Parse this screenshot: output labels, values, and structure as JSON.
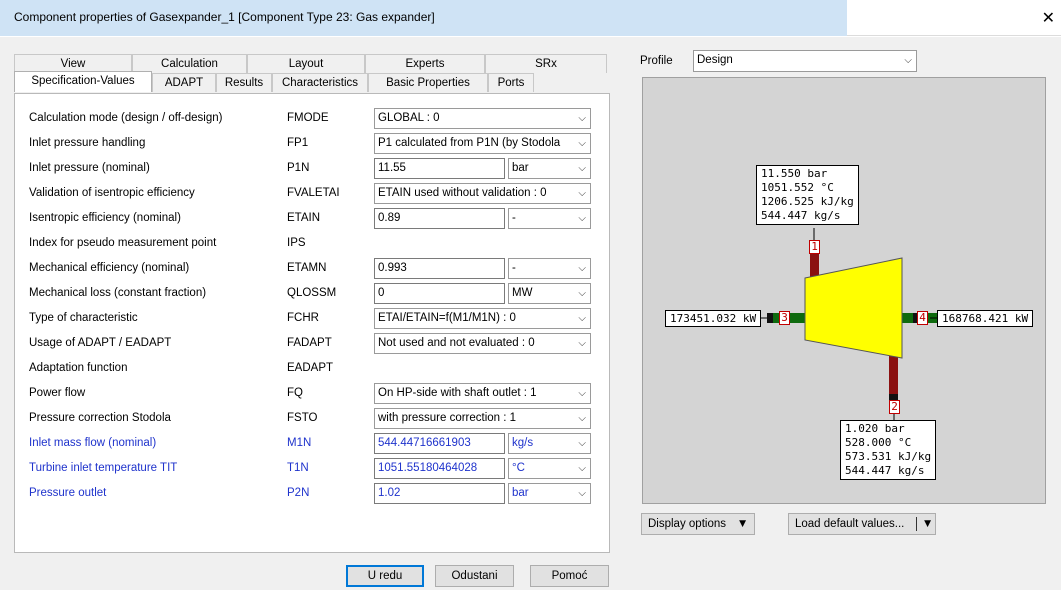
{
  "window": {
    "title": "Component properties of Gasexpander_1   [Component Type 23: Gas expander]",
    "close_glyph": "✕"
  },
  "tabs": {
    "row1": [
      "View",
      "Calculation",
      "Layout",
      "Experts",
      "SRx"
    ],
    "row2": [
      "Specification-Values",
      "ADAPT",
      "Results",
      "Characteristics",
      "Basic Properties",
      "Ports"
    ]
  },
  "spec": {
    "rows": [
      {
        "desc": "Calculation mode (design / off-design)",
        "code": "FMODE",
        "value": "GLOBAL : 0"
      },
      {
        "desc": "Inlet pressure handling",
        "code": "FP1",
        "value": "P1 calculated from P1N  (by Stodola"
      },
      {
        "desc": "Inlet pressure (nominal)",
        "code": "P1N",
        "value": "11.55",
        "unit": "bar"
      },
      {
        "desc": "Validation of isentropic efficiency",
        "code": "FVALETAI",
        "value": "ETAIN used without validation : 0"
      },
      {
        "desc": "Isentropic efficiency (nominal)",
        "code": "ETAIN",
        "value": "0.89",
        "unit": "-"
      },
      {
        "desc": "Index for pseudo measurement point",
        "code": "IPS"
      },
      {
        "desc": "Mechanical efficiency (nominal)",
        "code": "ETAMN",
        "value": "0.993",
        "unit": "-"
      },
      {
        "desc": "Mechanical loss (constant fraction)",
        "code": "QLOSSM",
        "value": "0",
        "unit": "MW"
      },
      {
        "desc": "Type of characteristic",
        "code": "FCHR",
        "value": "ETAI/ETAIN=f(M1/M1N) : 0"
      },
      {
        "desc": "Usage of ADAPT / EADAPT",
        "code": "FADAPT",
        "value": "Not used and not evaluated : 0"
      },
      {
        "desc": "Adaptation function",
        "code": "EADAPT"
      },
      {
        "desc": "Power flow",
        "code": "FQ",
        "value": "On HP-side with shaft outlet : 1"
      },
      {
        "desc": "Pressure correction Stodola",
        "code": "FSTO",
        "value": "with pressure correction : 1"
      },
      {
        "desc": "Inlet mass flow (nominal)",
        "code": "M1N",
        "value": "544.44716661903",
        "unit": "kg/s"
      },
      {
        "desc": "Turbine inlet temperature TIT",
        "code": "T1N",
        "value": "1051.55180464028",
        "unit": "°C"
      },
      {
        "desc": "Pressure outlet",
        "code": "P2N",
        "value": "1.02",
        "unit": "bar"
      }
    ]
  },
  "buttons": {
    "ok": "U redu",
    "cancel": "Odustani",
    "help": "Pomoć",
    "display_options": "Display options",
    "load_defaults": "Load default values..."
  },
  "profile": {
    "label": "Profile",
    "value": "Design"
  },
  "diagram": {
    "inlet": [
      "11.550 bar",
      "1051.552 °C",
      "1206.525 kJ/kg",
      "544.447 kg/s"
    ],
    "outlet": [
      "1.020 bar",
      "528.000 °C",
      "573.531 kJ/kg",
      "544.447 kg/s"
    ],
    "shaft_in": "173451.032 kW",
    "shaft_out": "168768.421 kW",
    "ports": [
      "1",
      "2",
      "3",
      "4"
    ]
  },
  "colors": {
    "turbine_fill": "#ffff00",
    "port_hot": "#8b1010",
    "port_shaft": "#107010",
    "label_blue": "#1f33cc"
  }
}
